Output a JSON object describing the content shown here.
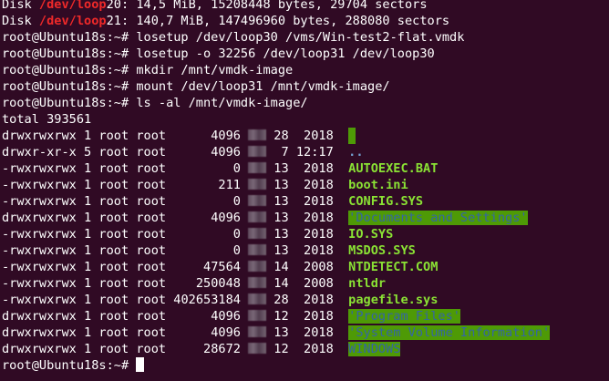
{
  "terminal": {
    "header_lines": [
      {
        "pre": "Disk ",
        "dev": "/dev/loop",
        "post": "20: 14,5 MiB, 15208448 bytes, 29704 sectors"
      },
      {
        "pre": "Disk ",
        "dev": "/dev/loop",
        "post": "21: 140,7 MiB, 147496960 bytes, 288080 sectors"
      }
    ],
    "prompt": "root@Ubuntu18s:~#",
    "commands": [
      "losetup /dev/loop30 /vms/Win-test2-flat.vmdk",
      "losetup -o 32256 /dev/loop31 /dev/loop30",
      "mkdir /mnt/vmdk-image",
      "mount /dev/loop31 /mnt/vmdk-image/",
      "ls -al /mnt/vmdk-image/"
    ],
    "total": "total 393561",
    "entries": [
      {
        "perm": "drwxrwxrwx",
        "links": "1",
        "owner": "root",
        "group": "root",
        "size": "4096",
        "day": "28",
        "time": "2018",
        "name": "",
        "style": "hl-empty"
      },
      {
        "perm": "drwxr-xr-x",
        "links": "5",
        "owner": "root",
        "group": "root",
        "size": "4096",
        "day": "7",
        "time": "12:17",
        "name": "..",
        "style": "dotdot"
      },
      {
        "perm": "-rwxrwxrwx",
        "links": "1",
        "owner": "root",
        "group": "root",
        "size": "0",
        "day": "13",
        "time": "2018",
        "name": "AUTOEXEC.BAT",
        "style": "green"
      },
      {
        "perm": "-rwxrwxrwx",
        "links": "1",
        "owner": "root",
        "group": "root",
        "size": "211",
        "day": "13",
        "time": "2018",
        "name": "boot.ini",
        "style": "green"
      },
      {
        "perm": "-rwxrwxrwx",
        "links": "1",
        "owner": "root",
        "group": "root",
        "size": "0",
        "day": "13",
        "time": "2018",
        "name": "CONFIG.SYS",
        "style": "green"
      },
      {
        "perm": "drwxrwxrwx",
        "links": "1",
        "owner": "root",
        "group": "root",
        "size": "4096",
        "day": "13",
        "time": "2018",
        "name": "'Documents and Settings'",
        "style": "hl"
      },
      {
        "perm": "-rwxrwxrwx",
        "links": "1",
        "owner": "root",
        "group": "root",
        "size": "0",
        "day": "13",
        "time": "2018",
        "name": "IO.SYS",
        "style": "green"
      },
      {
        "perm": "-rwxrwxrwx",
        "links": "1",
        "owner": "root",
        "group": "root",
        "size": "0",
        "day": "13",
        "time": "2018",
        "name": "MSDOS.SYS",
        "style": "green"
      },
      {
        "perm": "-rwxrwxrwx",
        "links": "1",
        "owner": "root",
        "group": "root",
        "size": "47564",
        "day": "14",
        "time": "2008",
        "name": "NTDETECT.COM",
        "style": "green"
      },
      {
        "perm": "-rwxrwxrwx",
        "links": "1",
        "owner": "root",
        "group": "root",
        "size": "250048",
        "day": "14",
        "time": "2008",
        "name": "ntldr",
        "style": "green"
      },
      {
        "perm": "-rwxrwxrwx",
        "links": "1",
        "owner": "root",
        "group": "root",
        "size": "402653184",
        "day": "28",
        "time": "2018",
        "name": "pagefile.sys",
        "style": "green"
      },
      {
        "perm": "drwxrwxrwx",
        "links": "1",
        "owner": "root",
        "group": "root",
        "size": "4096",
        "day": "12",
        "time": "2018",
        "name": "'Program Files'",
        "style": "hl"
      },
      {
        "perm": "drwxrwxrwx",
        "links": "1",
        "owner": "root",
        "group": "root",
        "size": "4096",
        "day": "13",
        "time": "2018",
        "name": "'System Volume Information'",
        "style": "hl"
      },
      {
        "perm": "drwxrwxrwx",
        "links": "1",
        "owner": "root",
        "group": "root",
        "size": "28672",
        "day": "12",
        "time": "2018",
        "name": "WINDOWS",
        "style": "hl"
      }
    ],
    "colors": {
      "background": "#300a24",
      "foreground": "#ffffff",
      "red": "#ef2929",
      "green": "#8ae234",
      "highlight_bg": "#4e9a06",
      "highlight_fg": "#3465a4",
      "dotdot": "#729fcf"
    }
  }
}
